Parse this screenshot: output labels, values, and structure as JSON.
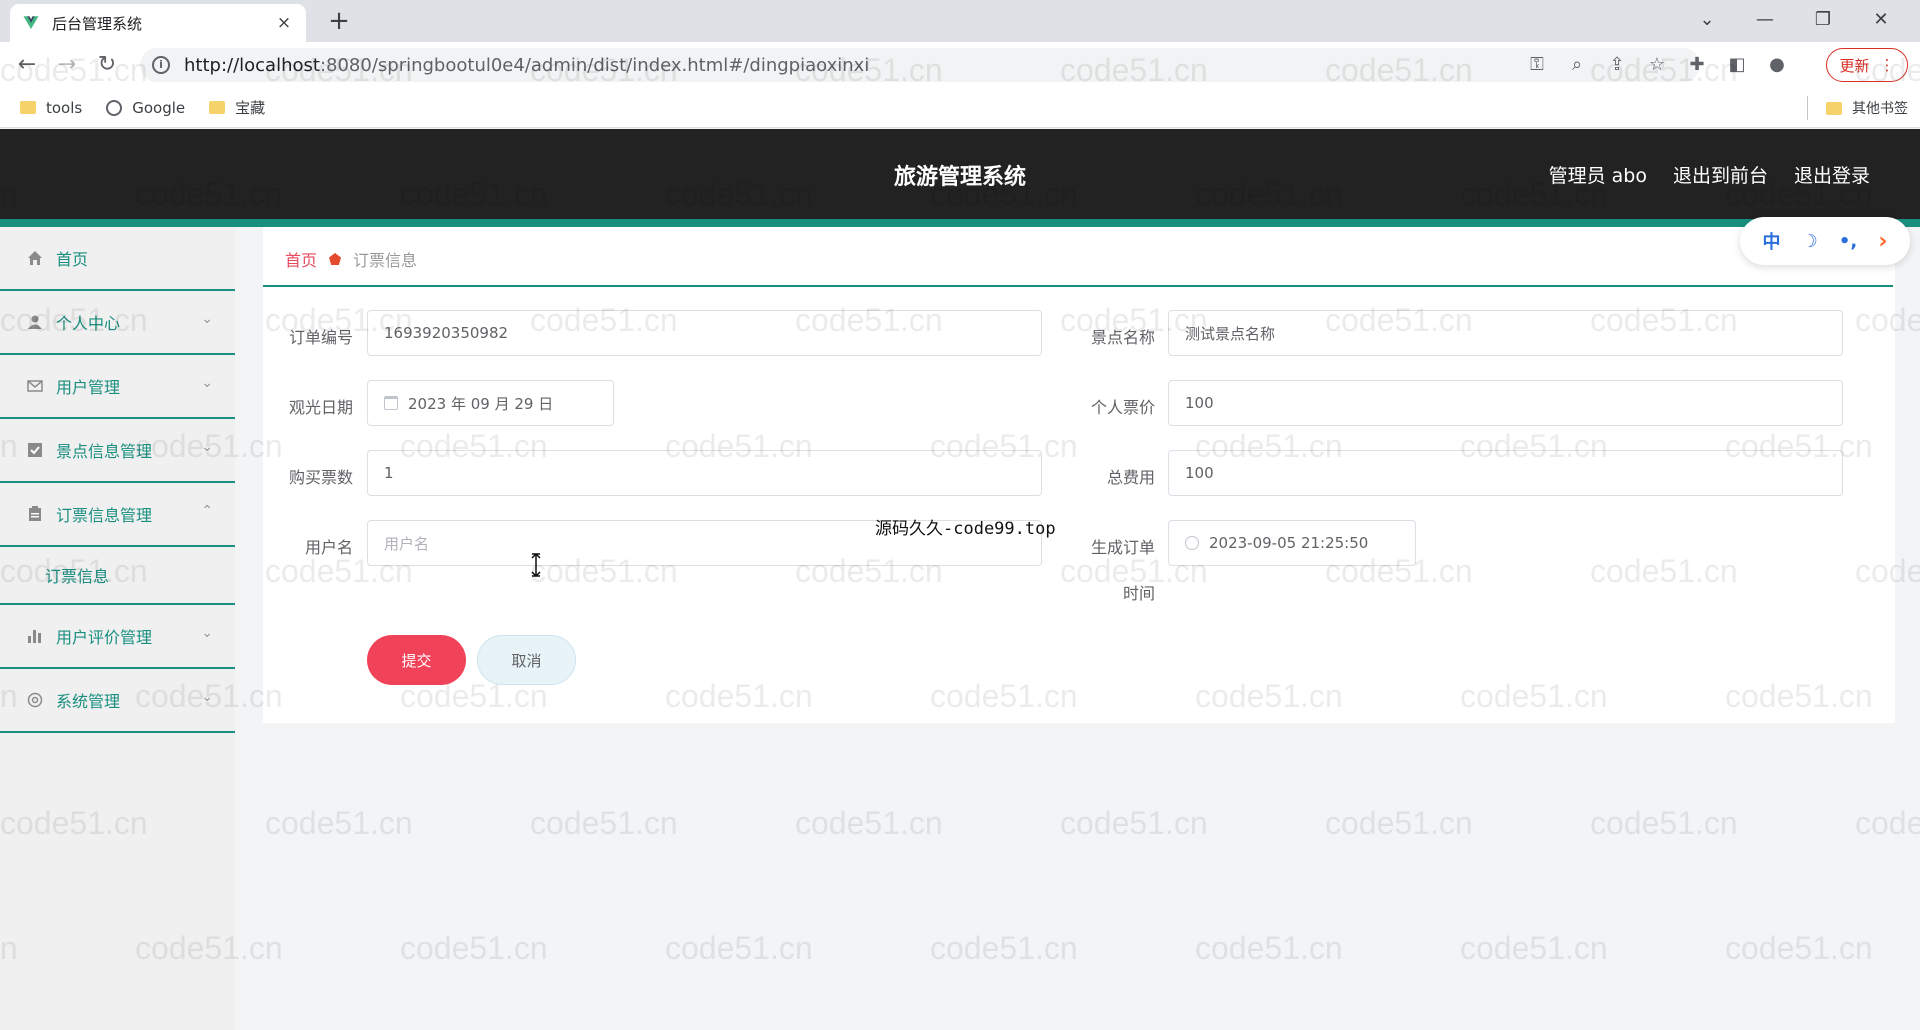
{
  "browser": {
    "tab_title": "后台管理系统",
    "tab_close": "×",
    "new_tab": "+",
    "url_host": "http://localhost",
    "url_path": ":8080/springbootul0e4/admin/dist/index.html#/dingpiaoxinxi",
    "update_label": "更新",
    "bookmarks": [
      "tools",
      "Google",
      "宝藏"
    ],
    "other_bookmarks": "其他书签"
  },
  "app": {
    "title": "旅游管理系统",
    "header_links": [
      "管理员 abo",
      "退出到前台",
      "退出登录"
    ]
  },
  "sidebar": {
    "items": [
      {
        "label": "首页",
        "icon": "home-icon"
      },
      {
        "label": "个人中心",
        "icon": "user-icon"
      },
      {
        "label": "用户管理",
        "icon": "mail-icon"
      },
      {
        "label": "景点信息管理",
        "icon": "check-square-icon"
      },
      {
        "label": "订票信息管理",
        "icon": "clipboard-icon"
      },
      {
        "label": "用户评价管理",
        "icon": "bar-chart-icon"
      },
      {
        "label": "系统管理",
        "icon": "settings-icon"
      }
    ],
    "submenu_active": "订票信息"
  },
  "breadcrumb": {
    "home": "首页",
    "current": "订票信息"
  },
  "float_tool": [
    "中",
    "☽",
    "•,",
    "›"
  ],
  "form": {
    "order_no_label": "订单编号",
    "order_no": "1693920350982",
    "spot_name_label": "景点名称",
    "spot_name": "测试景点名称",
    "visit_date_label": "观光日期",
    "visit_date": "2023 年 09 月 29 日",
    "price_label": "个人票价",
    "price": "100",
    "count_label": "购买票数",
    "count": "1",
    "total_label": "总费用",
    "total": "100",
    "username_label": "用户名",
    "username_placeholder": "用户名",
    "created_label_1": "生成订单",
    "created_label_2": "时间",
    "created_time": "2023-09-05 21:25:50",
    "submit": "提交",
    "cancel": "取消"
  },
  "overlay": "源码久久-code99.top",
  "watermark": "code51.cn",
  "colors": {
    "accent": "#1a8f80",
    "submit": "#f04258",
    "header_bg": "#222222"
  }
}
